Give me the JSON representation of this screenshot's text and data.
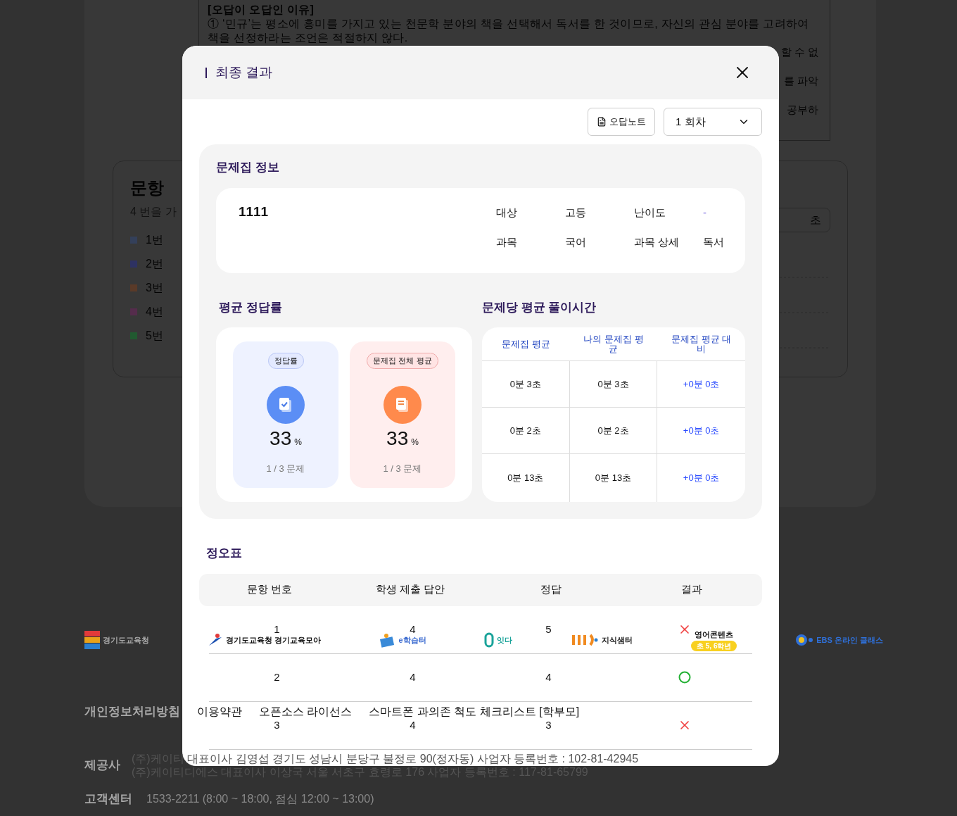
{
  "background": {
    "reason_box": {
      "title": "[오답이 오답인 이유]",
      "paragraph": "① ‘민규’는 평소에 흥미를 가지고 있는 천문학 분야의 책을 선택해서 독서를 한 것이므로, 자신의 관심 분야를 고려하여 책을 선정하라는 조언은 적절하지 않다.",
      "fragments": [
        "할 수 없",
        "를 파악",
        "공부하"
      ]
    },
    "question_card": {
      "title": "문항",
      "subtitle": "4 번을 가",
      "button": "초",
      "legend": [
        {
          "label": "1번",
          "color": "#34405a"
        },
        {
          "label": "2번",
          "color": "#2e3262"
        },
        {
          "label": "3번",
          "color": "#5a3a28"
        },
        {
          "label": "4번",
          "color": "#552c4c"
        },
        {
          "label": "5번",
          "color": "#215a30"
        }
      ]
    }
  },
  "modal": {
    "title": "최종 결과",
    "wrong_note_button": "오답노트",
    "round_select": {
      "value": "1 회차"
    },
    "info": {
      "title": "문제집 정보",
      "name": "1111",
      "fields": [
        {
          "label": "대상",
          "value": "고등"
        },
        {
          "label": "난이도",
          "value": "-"
        },
        {
          "label": "과목",
          "value": "국어"
        },
        {
          "label": "과목 상세",
          "value": "독서"
        }
      ]
    },
    "accuracy": {
      "title": "평균 정답률",
      "tiles": [
        {
          "kind": "mine",
          "badge": "정답률",
          "value": "33",
          "unit": "%",
          "count": "1 / 3 문제"
        },
        {
          "kind": "overall",
          "badge": "문제집 전체 평균",
          "value": "33",
          "unit": "%",
          "count": "1 / 3 문제"
        }
      ]
    },
    "time": {
      "title": "문제당 평균 풀이시간",
      "columns": [
        "문제집 평균",
        "나의 문제집 평균",
        "문제집 평균 대비"
      ],
      "rows": [
        {
          "avg": "0분 3초",
          "mine": "0분 3초",
          "diff": "+0분 0초"
        },
        {
          "avg": "0분 2초",
          "mine": "0분 2초",
          "diff": "+0분 0초"
        },
        {
          "avg": "0분 13초",
          "mine": "0분 13초",
          "diff": "+0분 0초"
        }
      ]
    },
    "answers": {
      "title": "정오표",
      "columns": [
        "문항 번호",
        "학생 제출 답안",
        "정답",
        "결과"
      ],
      "rows": [
        {
          "number": "1",
          "submitted": "4",
          "answer": "5",
          "correct": false
        },
        {
          "number": "2",
          "submitted": "4",
          "answer": "4",
          "correct": true
        },
        {
          "number": "3",
          "submitted": "4",
          "answer": "3",
          "correct": false
        }
      ]
    }
  },
  "footer": {
    "logos": [
      {
        "text": "경기도교육청",
        "color": "#a8a8a8"
      },
      {
        "text": "경기도교육청 경기교육모아",
        "color": "#111111"
      },
      {
        "text": "e학습터",
        "color": "#3a6ad0"
      },
      {
        "text": "잇다",
        "color": "#1aa39a"
      },
      {
        "text": "지식샘터",
        "color": "#222222"
      },
      {
        "text": "영어콘텐츠",
        "tag": "초 5, 6학년",
        "color": "#111111"
      },
      {
        "text": "EBS 온라인 클래스",
        "color": "#2f6fd6"
      }
    ],
    "links": [
      "개인정보처리방침",
      "이용약관",
      "오픈소스 라이선스",
      "스마트폰 과의존 척도 체크리스트 [학부모]"
    ],
    "provider_label": "제공사",
    "provider_lines": [
      "(주)케이티 대표이사 김영섭 경기도 성남시 분당구 불정로 90(정자동) 사업자 등록번호 : 102-81-42945",
      "(주)케이티디에스 대표이사 이상국 서울 서초구 효령로 176 사업자 등록번호 : 117-81-65799"
    ],
    "support_label": "고객센터",
    "support": "1533-2211 (8:00 ~ 18:00, 점심 12:00 ~ 13:00)"
  }
}
